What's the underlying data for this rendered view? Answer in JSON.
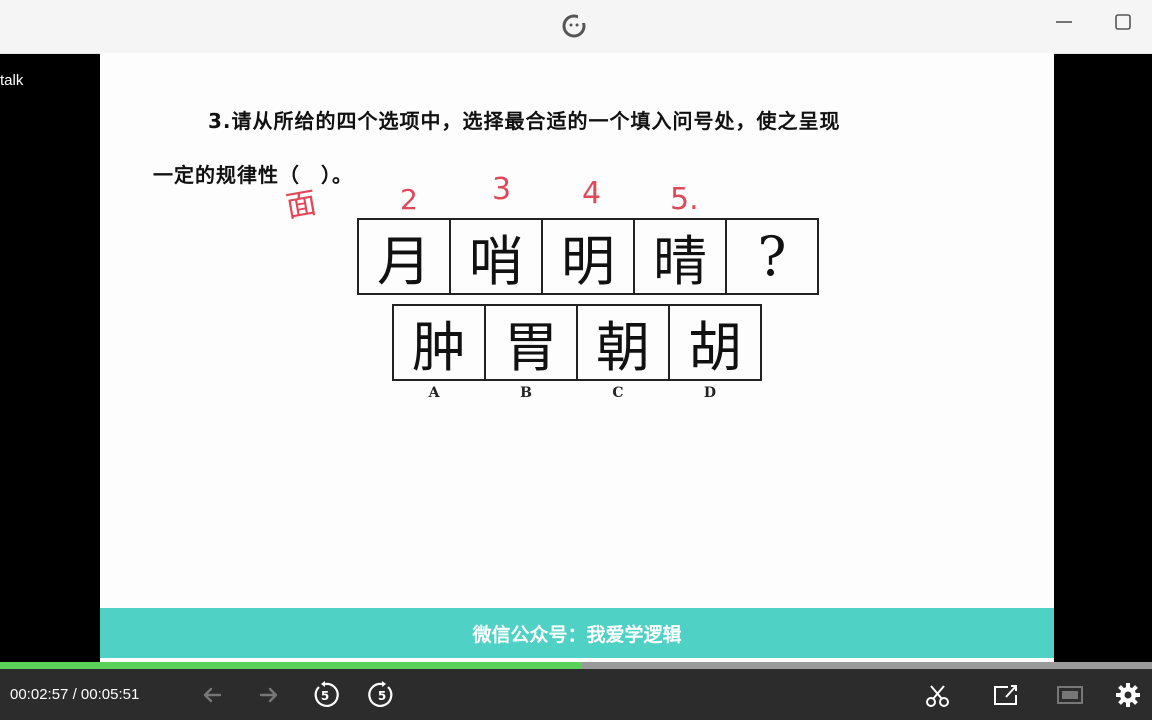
{
  "side": {
    "label": "talk"
  },
  "question": {
    "line1": "3.请从所给的四个选项中，选择最合适的一个填入问号处，使之呈现",
    "line2": "一定的规律性（　）。"
  },
  "grid": {
    "top_row": [
      "月",
      "哨",
      "明",
      "晴",
      "?"
    ],
    "options": [
      "肿",
      "胃",
      "朝",
      "胡"
    ],
    "option_labels": [
      "A",
      "B",
      "C",
      "D"
    ]
  },
  "annotations": {
    "handwritten": [
      "面",
      "2",
      "3",
      "4",
      "5."
    ],
    "color": "#e0485a"
  },
  "banner": {
    "text": "微信公众号：我爱学逻辑",
    "color": "#4fd1c5"
  },
  "player": {
    "current_time": "00:02:57",
    "separator": "/",
    "total_time": "00:05:51",
    "progress_fraction": 0.505,
    "progress_color": "#5ad15a",
    "skip_back_seconds": "5",
    "skip_forward_seconds": "5",
    "icons": [
      "arrow-left-icon",
      "arrow-right-icon",
      "rewind-5-icon",
      "forward-5-icon",
      "scissors-icon",
      "screenshot-icon",
      "screen-mode-icon",
      "gear-icon"
    ]
  }
}
